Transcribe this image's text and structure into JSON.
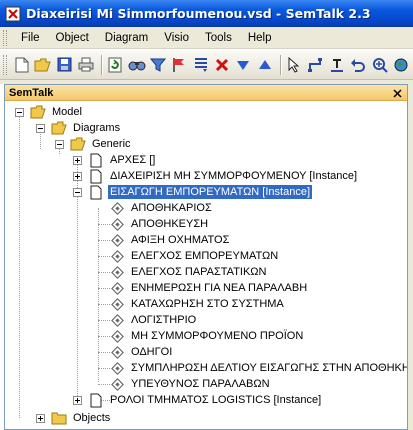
{
  "window": {
    "title": "Diaxeirisi Mi Simmorfoumenou.vsd - SemTalk 2.3"
  },
  "menu": [
    "File",
    "Object",
    "Diagram",
    "Visio",
    "Tools",
    "Help"
  ],
  "panel": {
    "title": "SemTalk",
    "close_icon": "x"
  },
  "tree": {
    "model": "Model",
    "diagrams": "Diagrams",
    "generic": "Generic",
    "pages": [
      "ΑΡΧΕΣ []",
      "ΔΙΑΧΕΙΡΙΣΗ ΜΗ ΣΥΜΜΟΡΦΟΥΜΕΝΟΥ [Instance]",
      "ΕΙΣΑΓΩΓΗ ΕΜΠΟΡΕΥΜΑΤΩΝ [Instance]"
    ],
    "children": [
      "ΑΠΟΘΗΚΑΡΙΟΣ",
      "ΑΠΟΘΗΚΕΥΣΗ",
      "ΑΦΙΞΗ ΟΧΗΜΑΤΟΣ",
      "ΕΛΕΓΧΟΣ ΕΜΠΟΡΕΥΜΑΤΩΝ",
      "ΕΛΕΓΧΟΣ ΠΑΡΑΣΤΑΤΙΚΩΝ",
      "ΕΝΗΜΕΡΩΣΗ ΓΙΑ ΝΕΑ ΠΑΡΑΛΑΒΗ",
      "ΚΑΤΑΧΩΡΗΣΗ ΣΤΟ ΣΥΣΤΗΜΑ",
      "ΛΟΓΙΣΤΗΡΙΟ",
      "ΜΗ ΣΥΜΜΟΡΦΟΥΜΕΝΟ ΠΡΟΪΟΝ",
      "ΟΔΗΓΟΙ",
      "ΣΥΜΠΛΗΡΩΣΗ ΔΕΛΤΙΟΥ ΕΙΣΑΓΩΓΗΣ ΣΤΗΝ ΑΠΟΘΗΚΗ",
      "ΥΠΕΥΘΥΝΟΣ ΠΑΡΑΛΑΒΩΝ"
    ],
    "last_page": "ΡΟΛΟΙ ΤΜΗΜΑΤΟΣ LOGISTICS [Instance]",
    "objects": "Objects"
  },
  "colors": {
    "titlebar": "#0a5ae0",
    "selection": "#316ac5",
    "panel_header": "#f4c66a",
    "chrome": "#ece9d8"
  },
  "toolbar_icons": [
    "new-icon",
    "open-icon",
    "save-icon",
    "print-icon",
    "refresh-icon",
    "find-icon",
    "filter-icon",
    "flag-icon",
    "list-icon",
    "delete-icon",
    "arrow-down-icon",
    "arrow-up-icon",
    "pointer-icon",
    "connector-icon",
    "format-icon",
    "undo-icon",
    "zoom-icon",
    "globe-icon"
  ]
}
